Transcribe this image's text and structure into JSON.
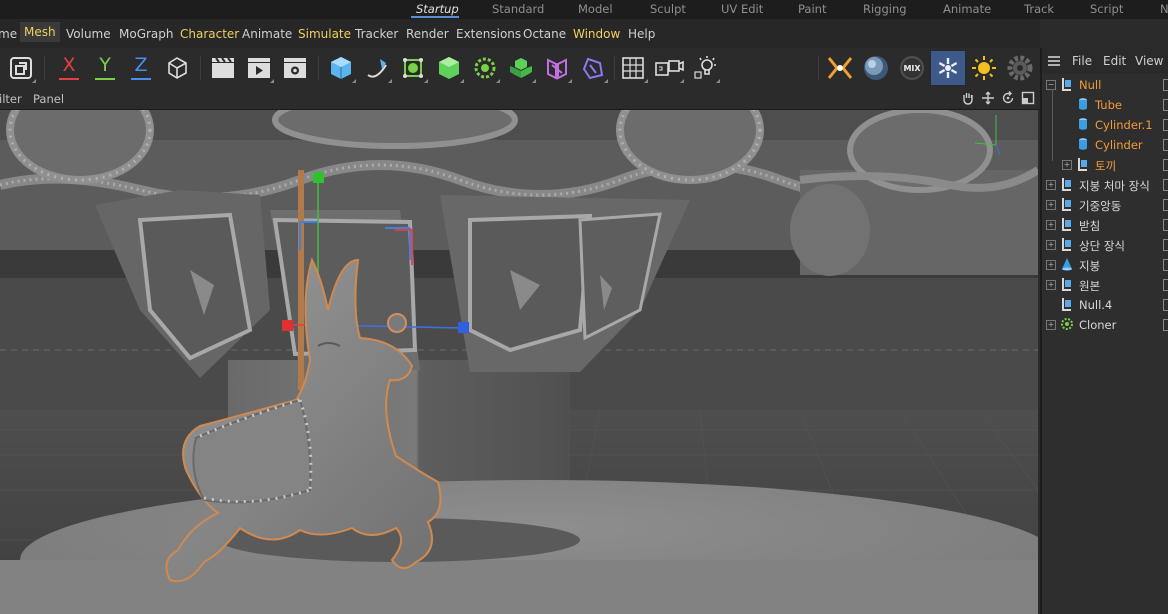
{
  "layout_tabs": [
    {
      "label": "Startup",
      "active": true
    },
    {
      "label": "Standard"
    },
    {
      "label": "Model"
    },
    {
      "label": "Sculpt"
    },
    {
      "label": "UV Edit"
    },
    {
      "label": "Paint"
    },
    {
      "label": "Rigging"
    },
    {
      "label": "Animate"
    },
    {
      "label": "Track"
    },
    {
      "label": "Script"
    },
    {
      "label": "N"
    }
  ],
  "menu": [
    "me",
    "Mesh",
    "Volume",
    "MoGraph",
    "Character",
    "Animate",
    "Simulate",
    "Tracker",
    "Render",
    "Extensions",
    "Octane",
    "Window",
    "Help"
  ],
  "toolbar": {
    "axis_x": "X",
    "axis_y": "Y",
    "axis_z": "Z",
    "mix_label": "MIX",
    "icons": [
      "model-mode-icon",
      "x-axis-icon",
      "y-axis-icon",
      "z-axis-icon",
      "coordinate-system-icon",
      "render-view-icon",
      "render-picture-viewer-icon",
      "render-settings-icon",
      "cube-icon",
      "spline-pen-icon",
      "subdivision-surface-icon",
      "extrude-icon",
      "cloner-icon",
      "mograph-icon",
      "deformer-icon",
      "hex-icon",
      "floor-icon",
      "camera-icon",
      "light-icon",
      "octane-kernel-icon",
      "octane-material-icon",
      "octane-mix-icon",
      "octane-settings-icon",
      "octane-sun-icon",
      "octane-gear-icon"
    ]
  },
  "viewport_menu": {
    "filter": "ilter",
    "panel": "Panel"
  },
  "object_manager": {
    "menu": {
      "file": "File",
      "edit": "Edit",
      "view": "View"
    },
    "items": [
      {
        "label": "Null",
        "color": "orange",
        "depth": 0,
        "icon": "null-icon",
        "toggle": "−"
      },
      {
        "label": "Tube",
        "color": "orange",
        "depth": 1,
        "icon": "tube-icon"
      },
      {
        "label": "Cylinder.1",
        "color": "orange",
        "depth": 1,
        "icon": "cylinder-icon"
      },
      {
        "label": "Cylinder",
        "color": "orange",
        "depth": 1,
        "icon": "cylinder-icon"
      },
      {
        "label": "토끼",
        "color": "orange",
        "depth": 1,
        "icon": "null-icon",
        "toggle": "+"
      },
      {
        "label": "지붕 처마 장식",
        "color": "white",
        "depth": 0,
        "icon": "null-icon",
        "toggle": "+"
      },
      {
        "label": "기중앙동",
        "color": "white",
        "depth": 0,
        "icon": "null-icon",
        "toggle": "+"
      },
      {
        "label": "받침",
        "color": "white",
        "depth": 0,
        "icon": "null-icon",
        "toggle": "+"
      },
      {
        "label": "상단 장식",
        "color": "white",
        "depth": 0,
        "icon": "null-icon",
        "toggle": "+"
      },
      {
        "label": "지붕",
        "color": "white",
        "depth": 0,
        "icon": "cone-icon",
        "toggle": "+"
      },
      {
        "label": "원본",
        "color": "white",
        "depth": 0,
        "icon": "null-icon",
        "toggle": "+"
      },
      {
        "label": "Null.4",
        "color": "white",
        "depth": 0,
        "icon": "null-icon"
      },
      {
        "label": "Cloner",
        "color": "white",
        "depth": 0,
        "icon": "cloner-icon",
        "toggle": "+"
      }
    ]
  },
  "colors": {
    "accent": "#5b8fd9",
    "selected_text": "#f29b3a",
    "menu_highlight": "#f0d060"
  }
}
